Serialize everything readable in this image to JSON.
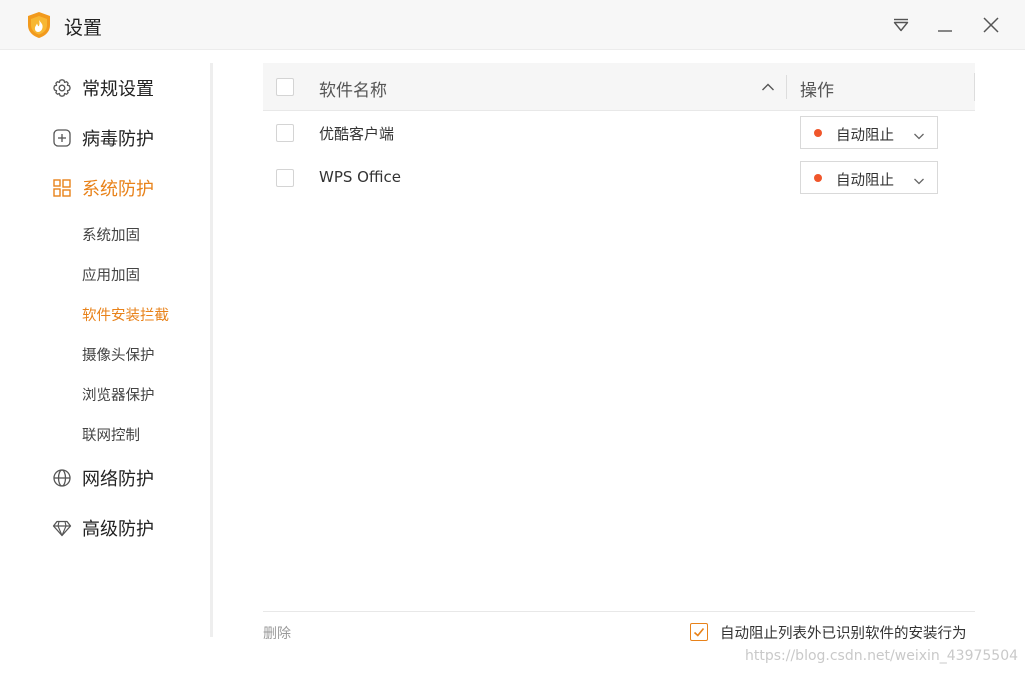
{
  "window": {
    "title": "设置",
    "accent_color": "#e8821a"
  },
  "sidebar": {
    "items": [
      {
        "label": "常规设置",
        "icon": "gear-icon"
      },
      {
        "label": "病毒防护",
        "icon": "plus-square-icon"
      },
      {
        "label": "系统防护",
        "icon": "system-grid-icon",
        "active": true
      },
      {
        "label": "网络防护",
        "icon": "globe-icon"
      },
      {
        "label": "高级防护",
        "icon": "diamond-icon"
      }
    ],
    "subitems": [
      {
        "label": "系统加固"
      },
      {
        "label": "应用加固"
      },
      {
        "label": "软件安装拦截",
        "active": true
      },
      {
        "label": "摄像头保护"
      },
      {
        "label": "浏览器保护"
      },
      {
        "label": "联网控制"
      }
    ]
  },
  "table": {
    "header": {
      "name": "软件名称",
      "operation": "操作"
    },
    "rows": [
      {
        "name": "优酷客户端",
        "action": "自动阻止",
        "status_color": "#f0562b"
      },
      {
        "name": "WPS Office",
        "action": "自动阻止",
        "status_color": "#f0562b"
      }
    ]
  },
  "footer": {
    "delete_label": "删除",
    "auto_block_label": "自动阻止列表外已识别软件的安装行为",
    "auto_block_checked": true
  },
  "watermark": "https://blog.csdn.net/weixin_43975504"
}
